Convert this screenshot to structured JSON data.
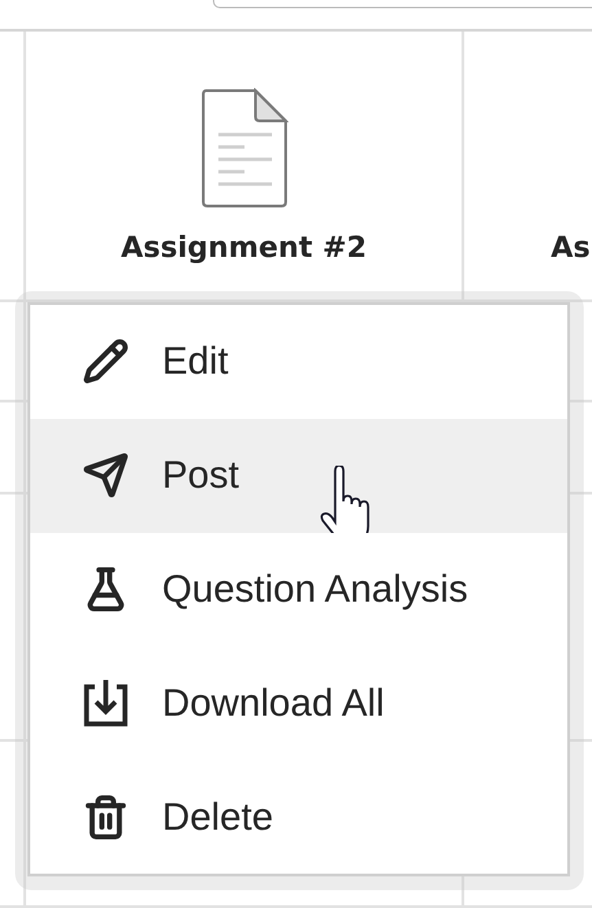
{
  "header": {
    "assignment_title": "Assignment #2",
    "next_column_title": "As"
  },
  "menu": {
    "items": [
      {
        "label": "Edit",
        "kind": "edit",
        "selected": false
      },
      {
        "label": "Post",
        "kind": "post",
        "selected": true
      },
      {
        "label": "Question Analysis",
        "kind": "analysis",
        "selected": false
      },
      {
        "label": "Download All",
        "kind": "download",
        "selected": false
      },
      {
        "label": "Delete",
        "kind": "delete",
        "selected": false
      }
    ]
  }
}
